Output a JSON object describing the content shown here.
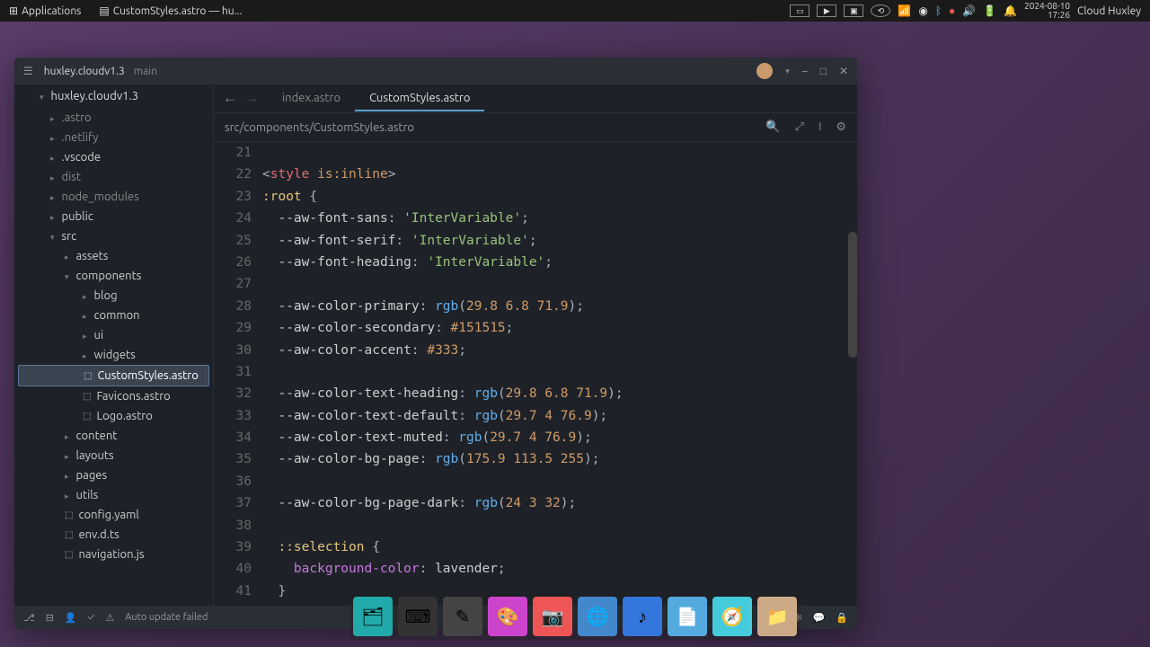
{
  "desktop": {
    "applications_label": "Applications",
    "window_tab_title": "CustomStyles.astro — hu...",
    "datetime_date": "2024-08-10",
    "datetime_time": "17:26",
    "username": "Cloud Huxley"
  },
  "editor": {
    "project_name": "huxley.cloudv1.3",
    "branch": "main",
    "window_controls": {
      "min": "–",
      "max": "□",
      "close": "✕"
    },
    "sidebar": {
      "root": "huxley.cloudv1.3",
      "items": [
        {
          "label": ".astro",
          "level": 1,
          "dim": true
        },
        {
          "label": ".netlify",
          "level": 1,
          "dim": true
        },
        {
          "label": ".vscode",
          "level": 1,
          "dim": false
        },
        {
          "label": "dist",
          "level": 1,
          "dim": true
        },
        {
          "label": "node_modules",
          "level": 1,
          "dim": true
        },
        {
          "label": "public",
          "level": 1,
          "dim": false
        },
        {
          "label": "src",
          "level": 1,
          "dim": false,
          "open": true
        },
        {
          "label": "assets",
          "level": 2,
          "dim": false
        },
        {
          "label": "components",
          "level": 2,
          "dim": false,
          "open": true
        },
        {
          "label": "blog",
          "level": 3,
          "dim": false
        },
        {
          "label": "common",
          "level": 3,
          "dim": false
        },
        {
          "label": "ui",
          "level": 3,
          "dim": false
        },
        {
          "label": "widgets",
          "level": 3,
          "dim": false
        },
        {
          "label": "CustomStyles.astro",
          "level": 3,
          "dim": false,
          "selected": true,
          "file": true
        },
        {
          "label": "Favicons.astro",
          "level": 3,
          "dim": false,
          "file": true
        },
        {
          "label": "Logo.astro",
          "level": 3,
          "dim": false,
          "file": true
        },
        {
          "label": "content",
          "level": 2,
          "dim": false
        },
        {
          "label": "layouts",
          "level": 2,
          "dim": false
        },
        {
          "label": "pages",
          "level": 2,
          "dim": false
        },
        {
          "label": "utils",
          "level": 2,
          "dim": false
        },
        {
          "label": "config.yaml",
          "level": 2,
          "dim": false,
          "file": true
        },
        {
          "label": "env.d.ts",
          "level": 2,
          "dim": false,
          "file": true
        },
        {
          "label": "navigation.js",
          "level": 2,
          "dim": false,
          "file": true
        }
      ]
    },
    "tabs": [
      {
        "label": "index.astro",
        "active": false
      },
      {
        "label": "CustomStyles.astro",
        "active": true
      }
    ],
    "breadcrumb": "src/components/CustomStyles.astro",
    "line_start": 21,
    "code_lines": [
      {
        "n": 21,
        "html": ""
      },
      {
        "n": 22,
        "html": "<span class='tok-punc'>&lt;</span><span class='tok-tag'>style</span> <span class='tok-attr'>is:inline</span><span class='tok-punc'>&gt;</span>"
      },
      {
        "n": 23,
        "html": "<span class='tok-sel'>:root</span> <span class='tok-punc'>{</span>"
      },
      {
        "n": 24,
        "html": "  <span class='tok-prop'>--aw-font-sans</span><span class='tok-punc'>:</span> <span class='tok-str'>'InterVariable'</span><span class='tok-punc'>;</span>"
      },
      {
        "n": 25,
        "html": "  <span class='tok-prop'>--aw-font-serif</span><span class='tok-punc'>:</span> <span class='tok-str'>'InterVariable'</span><span class='tok-punc'>;</span>"
      },
      {
        "n": 26,
        "html": "  <span class='tok-prop'>--aw-font-heading</span><span class='tok-punc'>:</span> <span class='tok-str'>'InterVariable'</span><span class='tok-punc'>;</span>"
      },
      {
        "n": 27,
        "html": ""
      },
      {
        "n": 28,
        "html": "  <span class='tok-prop'>--aw-color-primary</span><span class='tok-punc'>:</span> <span class='tok-func'>rgb</span><span class='tok-punc'>(</span><span class='tok-num'>29.8 6.8 71.9</span><span class='tok-punc'>);</span>"
      },
      {
        "n": 29,
        "html": "  <span class='tok-prop'>--aw-color-secondary</span><span class='tok-punc'>:</span> <span class='tok-num'>#151515</span><span class='tok-punc'>;</span>"
      },
      {
        "n": 30,
        "html": "  <span class='tok-prop'>--aw-color-accent</span><span class='tok-punc'>:</span> <span class='tok-num'>#333</span><span class='tok-punc'>;</span>"
      },
      {
        "n": 31,
        "html": ""
      },
      {
        "n": 32,
        "html": "  <span class='tok-prop'>--aw-color-text-heading</span><span class='tok-punc'>:</span> <span class='tok-func'>rgb</span><span class='tok-punc'>(</span><span class='tok-num'>29.8 6.8 71.9</span><span class='tok-punc'>);</span>"
      },
      {
        "n": 33,
        "html": "  <span class='tok-prop'>--aw-color-text-default</span><span class='tok-punc'>:</span> <span class='tok-func'>rgb</span><span class='tok-punc'>(</span><span class='tok-num'>29.7 4 76.9</span><span class='tok-punc'>);</span>"
      },
      {
        "n": 34,
        "html": "  <span class='tok-prop'>--aw-color-text-muted</span><span class='tok-punc'>:</span> <span class='tok-func'>rgb</span><span class='tok-punc'>(</span><span class='tok-num'>29.7 4 76.9</span><span class='tok-punc'>);</span>"
      },
      {
        "n": 35,
        "html": "  <span class='tok-prop'>--aw-color-bg-page</span><span class='tok-punc'>:</span> <span class='tok-func'>rgb</span><span class='tok-punc'>(</span><span class='tok-num'>175.9 113.5 255</span><span class='tok-punc'>);</span>"
      },
      {
        "n": 36,
        "html": ""
      },
      {
        "n": 37,
        "html": "  <span class='tok-prop'>--aw-color-bg-page-dark</span><span class='tok-punc'>:</span> <span class='tok-func'>rgb</span><span class='tok-punc'>(</span><span class='tok-num'>24 3 32</span><span class='tok-punc'>);</span>"
      },
      {
        "n": 38,
        "html": ""
      },
      {
        "n": 39,
        "html": "  <span class='tok-sel'>::selection</span> <span class='tok-punc'>{</span>"
      },
      {
        "n": 40,
        "html": "    <span class='tok-key'>background-color</span><span class='tok-punc'>:</span> <span class='tok-prop'>lavender</span><span class='tok-punc'>;</span>"
      },
      {
        "n": 41,
        "html": "  <span class='tok-punc'>}</span>"
      }
    ],
    "statusbar": {
      "update_msg": "Auto update failed"
    }
  },
  "dock_items": [
    "files",
    "terminal",
    "editor",
    "color",
    "photos",
    "earth",
    "music",
    "text",
    "web",
    "folder"
  ]
}
